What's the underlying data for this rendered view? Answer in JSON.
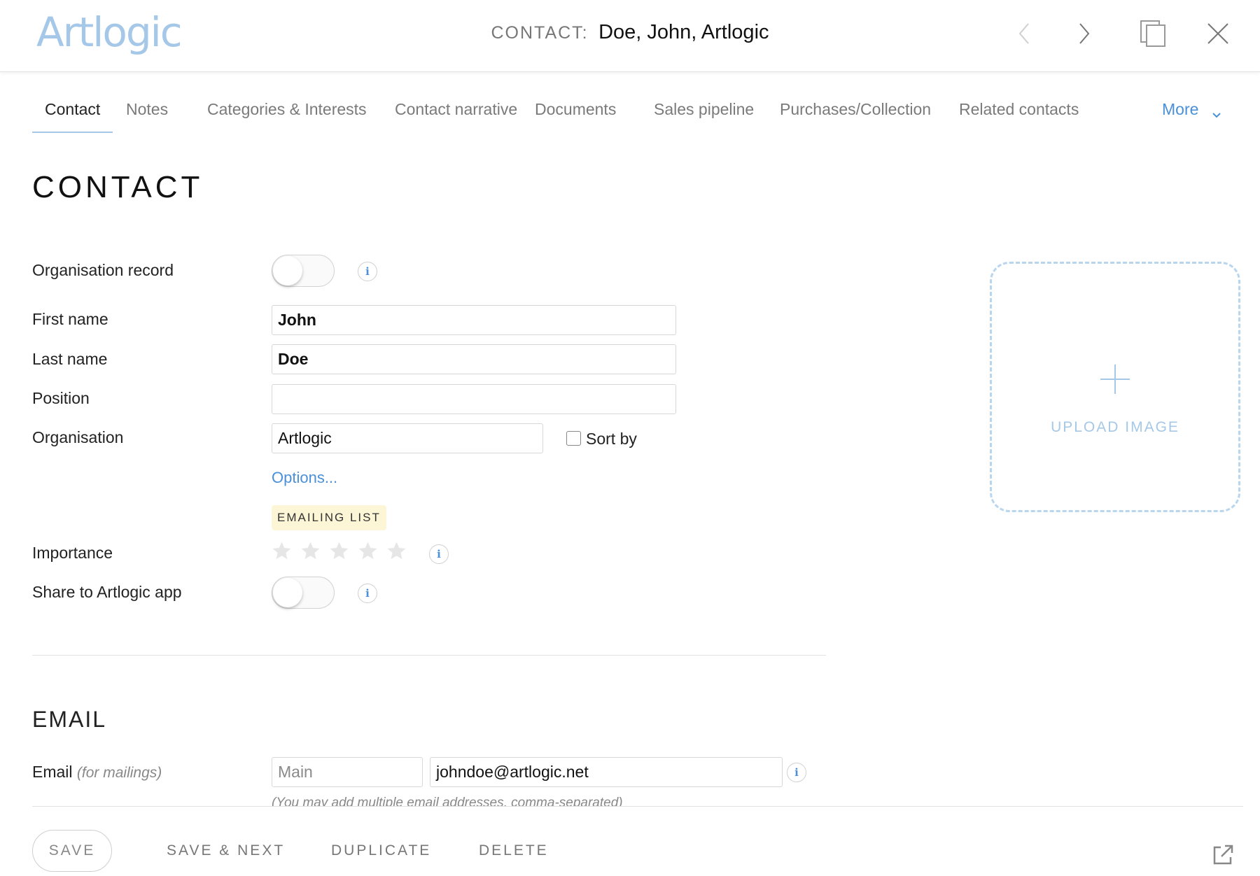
{
  "header": {
    "logo": "Artlogic",
    "record_label": "CONTACT:",
    "record_name": "Doe, John, Artlogic",
    "icons": [
      "chevron-left-icon",
      "chevron-right-icon",
      "copy-icon",
      "close-icon"
    ]
  },
  "tabs": {
    "items": [
      {
        "label": "Contact"
      },
      {
        "label": "Notes"
      },
      {
        "label": "Categories & Interests"
      },
      {
        "label": "Contact narrative"
      },
      {
        "label": "Documents"
      },
      {
        "label": "Sales pipeline"
      },
      {
        "label": "Purchases/Collection"
      },
      {
        "label": "Related contacts"
      }
    ],
    "more_label": "More",
    "active": "Contact"
  },
  "page": {
    "title": "CONTACT"
  },
  "form": {
    "organisation_record": {
      "label": "Organisation record",
      "on": false
    },
    "first_name": {
      "label": "First name",
      "value": "John"
    },
    "last_name": {
      "label": "Last name",
      "value": "Doe"
    },
    "position": {
      "label": "Position",
      "value": ""
    },
    "organisation": {
      "label": "Organisation",
      "value": "Artlogic",
      "sort_by_label": "Sort by",
      "sort_by_checked": false
    },
    "options_link": "Options...",
    "emailing_list_badge": "EMAILING LIST",
    "importance": {
      "label": "Importance",
      "rating": 0,
      "max": 5
    },
    "share_app": {
      "label": "Share to Artlogic app",
      "on": false
    },
    "info_glyph": "i"
  },
  "email_section": {
    "title": "EMAIL",
    "label": "Email",
    "label_hint": "(for mailings)",
    "type_placeholder": "Main",
    "address": "johndoe@artlogic.net",
    "note": "(You may add multiple email addresses, comma-separated)"
  },
  "upload": {
    "label": "UPLOAD IMAGE"
  },
  "footer": {
    "save": "SAVE",
    "save_next": "SAVE & NEXT",
    "duplicate": "DUPLICATE",
    "delete": "DELETE"
  },
  "colors": {
    "accent": "#4a90d9",
    "logo": "#a6c8e8",
    "badge_bg": "#fdf6d6"
  }
}
